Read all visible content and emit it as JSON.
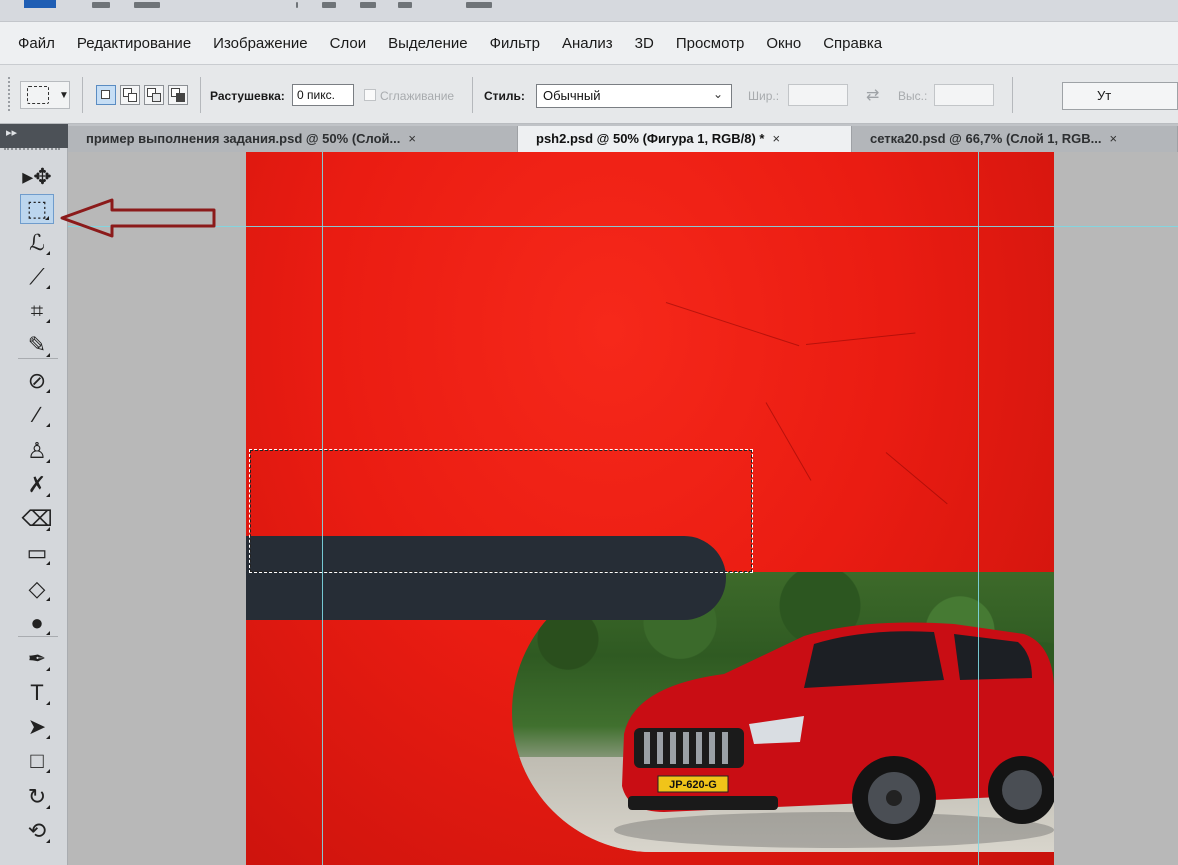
{
  "menubar": {
    "items": [
      "Файл",
      "Редактирование",
      "Изображение",
      "Слои",
      "Выделение",
      "Фильтр",
      "Анализ",
      "3D",
      "Просмотр",
      "Окно",
      "Справка"
    ]
  },
  "options": {
    "feather_label": "Растушевка:",
    "feather_value": "0 пикс.",
    "antialias_label": "Сглаживание",
    "style_label": "Стиль:",
    "style_value": "Обычный",
    "width_label": "Шир.:",
    "height_label": "Выс.:",
    "refine_label": "Ут"
  },
  "tabs": [
    {
      "label": "пример выполнения задания.psd @ 50% (Слой...",
      "close": "×",
      "active": false
    },
    {
      "label": "psh2.psd @ 50% (Фигура 1, RGB/8) *",
      "close": "×",
      "active": true
    },
    {
      "label": "сетка20.psd @ 66,7% (Слой 1, RGB...",
      "close": "×",
      "active": false
    }
  ],
  "tools": [
    {
      "name": "move-tool-icon",
      "glyph": "▸✥"
    },
    {
      "name": "rect-marquee-tool-icon",
      "glyph": "⬚"
    },
    {
      "name": "lasso-tool-icon",
      "glyph": "ℒ"
    },
    {
      "name": "quick-select-tool-icon",
      "glyph": "⟋"
    },
    {
      "name": "crop-tool-icon",
      "glyph": "⌗"
    },
    {
      "name": "eyedropper-tool-icon",
      "glyph": "✎"
    },
    {
      "name": "healing-brush-tool-icon",
      "glyph": "⊘"
    },
    {
      "name": "brush-tool-icon",
      "glyph": "∕"
    },
    {
      "name": "clone-stamp-tool-icon",
      "glyph": "♙"
    },
    {
      "name": "history-brush-tool-icon",
      "glyph": "✗"
    },
    {
      "name": "eraser-tool-icon",
      "glyph": "⌫"
    },
    {
      "name": "gradient-tool-icon",
      "glyph": "▭"
    },
    {
      "name": "blur-tool-icon",
      "glyph": "◇"
    },
    {
      "name": "dodge-tool-icon",
      "glyph": "●"
    },
    {
      "name": "pen-tool-icon",
      "glyph": "✒"
    },
    {
      "name": "type-tool-icon",
      "glyph": "T"
    },
    {
      "name": "path-select-tool-icon",
      "glyph": "➤"
    },
    {
      "name": "rectangle-shape-tool-icon",
      "glyph": "□"
    },
    {
      "name": "3d-rotate-tool-icon",
      "glyph": "↻"
    },
    {
      "name": "3d-orbit-tool-icon",
      "glyph": "⟲"
    }
  ],
  "canvas": {
    "plate_text": "JP-620-G"
  },
  "colors": {
    "canvas_red": "#ea1c12",
    "pill_dark": "#262d36",
    "guide": "#7ed9e4",
    "arrow": "#8b1a1a"
  }
}
